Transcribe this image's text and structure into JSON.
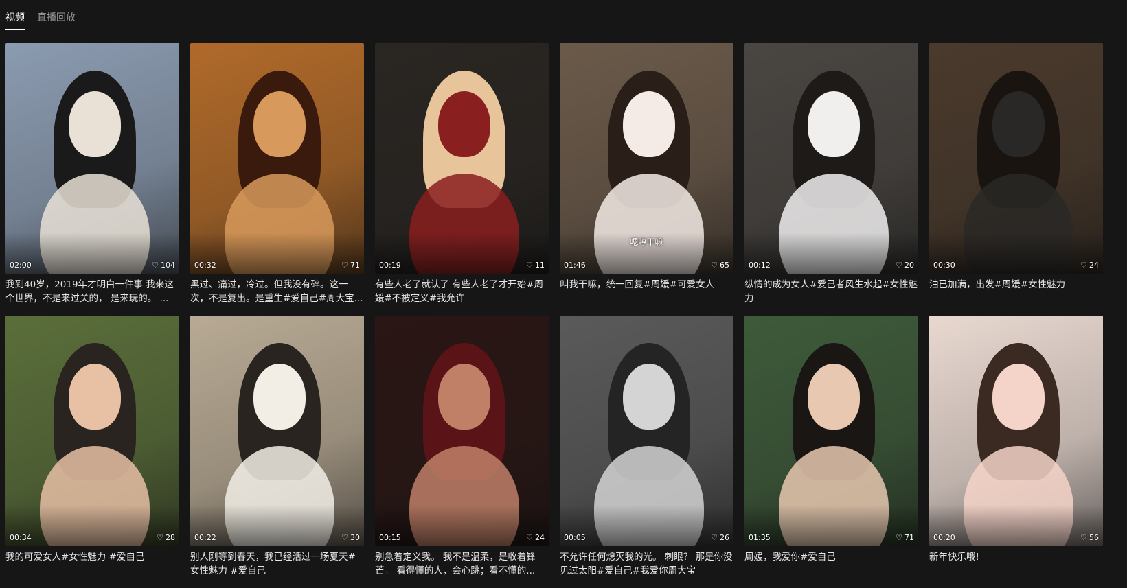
{
  "tabs": [
    {
      "label": "视频",
      "active": true
    },
    {
      "label": "直播回放",
      "active": false
    }
  ],
  "videos": [
    {
      "duration": "02:00",
      "likes": "104",
      "caption": "我到40岁，2019年才明白一件事 我来这个世界，不是来过关的， 是来玩的。 ...",
      "bg": "#8b9bb0",
      "fg": "#e9e1d6",
      "hair": "#1a1a1a"
    },
    {
      "duration": "00:32",
      "likes": "71",
      "caption": "黑过、痛过，冷过。但我没有碎。这一次，不是复出。是重生#爱自己#周大宝...",
      "bg": "#b06a2a",
      "fg": "#d89a5c",
      "hair": "#3a1a0c"
    },
    {
      "duration": "00:19",
      "likes": "11",
      "caption": "有些人老了就认了 有些人老了才开始#周媛#不被定义#我允许",
      "bg": "#2a2622",
      "fg": "#8a1f1f",
      "hair": "#e8c49a"
    },
    {
      "duration": "01:46",
      "likes": "65",
      "caption": "叫我干嘛，统一回复#周媛#可爱女人",
      "bg": "#6b5a4a",
      "fg": "#f4ebe6",
      "hair": "#2a1e18",
      "subtitle": "嗯哼干嘛"
    },
    {
      "duration": "00:12",
      "likes": "20",
      "caption": "纵情的成为女人#爱己者风生水起#女性魅力",
      "bg": "#4a4642",
      "fg": "#f0efee",
      "hair": "#1e1a18"
    },
    {
      "duration": "00:30",
      "likes": "24",
      "caption": "油已加满，出发#周媛#女性魅力",
      "bg": "#4a3a2c",
      "fg": "#2a2826",
      "hair": "#1a1410"
    },
    {
      "duration": "00:34",
      "likes": "28",
      "caption": "我的可爱女人#女性魅力 #爱自己",
      "bg": "#5a6e3a",
      "fg": "#e8c0a4",
      "hair": "#2a2420"
    },
    {
      "duration": "00:22",
      "likes": "30",
      "caption": "别人刚等到春天，我已经活过一场夏天#女性魅力 #爱自己",
      "bg": "#b8aa94",
      "fg": "#f2eee6",
      "hair": "#2a2420"
    },
    {
      "duration": "00:15",
      "likes": "24",
      "caption": "别急着定义我。 我不是温柔，是收着锋芒。 看得懂的人，会心跳；看不懂的...",
      "bg": "#2a1614",
      "fg": "#c08068",
      "hair": "#5a1418"
    },
    {
      "duration": "00:05",
      "likes": "26",
      "caption": "不允许任何熄灭我的光。 刺眼？ 那是你没见过太阳#爱自己#我爱你周大宝",
      "bg": "#5a5a5a",
      "fg": "#d4d4d4",
      "hair": "#242424"
    },
    {
      "duration": "01:35",
      "likes": "71",
      "caption": "周媛，我爱你#爱自己",
      "bg": "#3e5a3a",
      "fg": "#e8c8b0",
      "hair": "#1a1614"
    },
    {
      "duration": "00:20",
      "likes": "56",
      "caption": "新年快乐哦!",
      "bg": "#e8d8d0",
      "fg": "#f4d4c8",
      "hair": "#3a2a22"
    }
  ]
}
